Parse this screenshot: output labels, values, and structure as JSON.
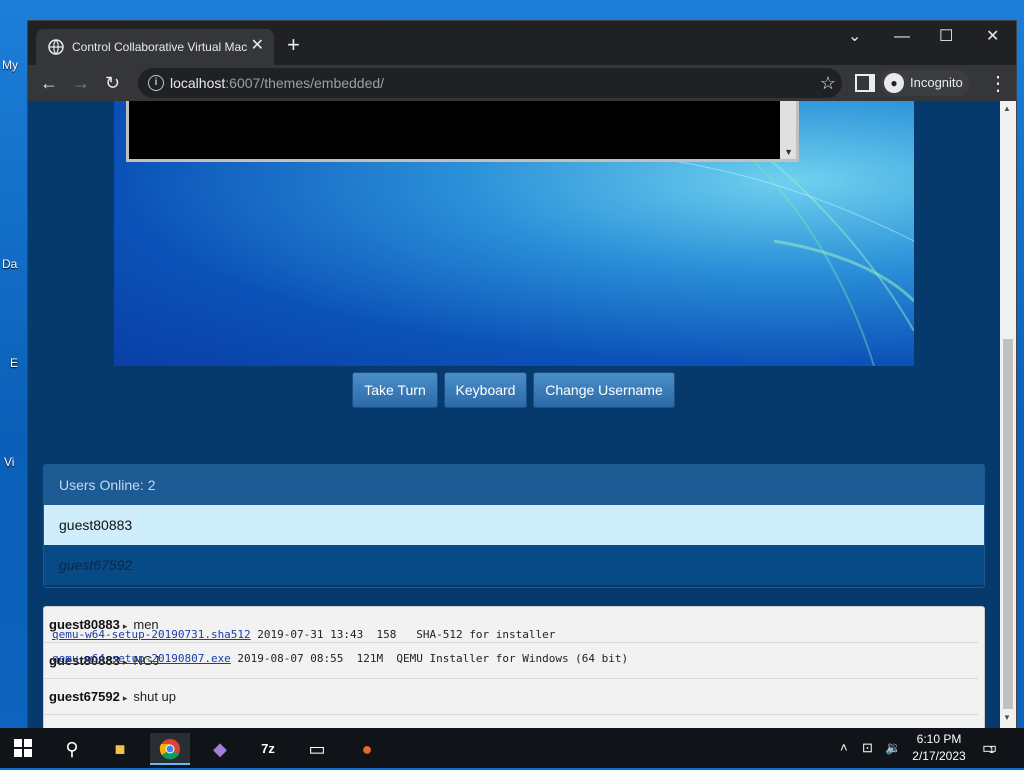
{
  "desktop": {
    "labels": [
      "My",
      "Da",
      "E",
      "Vi"
    ]
  },
  "browser": {
    "tab_title": "Control Collaborative Virtual Mac",
    "tab_close": "✕",
    "new_tab": "+",
    "url_host": "localhost",
    "url_rest": ":6007/themes/embedded/",
    "incognito_label": "Incognito",
    "window_controls": {
      "tabsearch": "⌄",
      "minimize": "—",
      "maximize": "☐",
      "close": "✕"
    }
  },
  "vm": {
    "buttons": {
      "take_turn": "Take Turn",
      "keyboard": "Keyboard",
      "change_username": "Change Username"
    }
  },
  "users": {
    "header": "Users Online: 2",
    "list": [
      "guest80883",
      "guest67592"
    ]
  },
  "chat": {
    "messages": [
      {
        "user": "guest80883",
        "text": "men"
      },
      {
        "user": "guest80883",
        "text": "NGJ"
      },
      {
        "user": "guest67592",
        "text": "shut up"
      }
    ]
  },
  "listing": {
    "line1_link": "qemu-w64-setup-20190731.sha512",
    "line1_rest": " 2019-07-31 13:43  158   SHA-512 for installer",
    "line2_link": "qemu-w64-setup-20190807.exe",
    "line2_rest": " 2019-08-07 08:55  121M  QEMU Installer for Windows (64 bit)"
  },
  "taskbar": {
    "time": "6:10 PM",
    "date": "2/17/2023",
    "notification_count": "1"
  }
}
